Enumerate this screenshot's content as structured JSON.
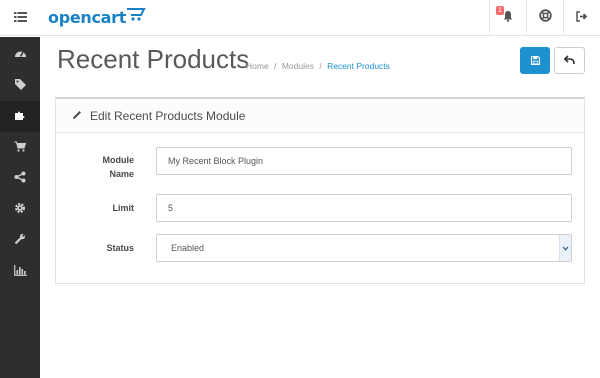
{
  "header": {
    "logo_text": "opencart",
    "notification_count": "1"
  },
  "icons": {
    "menu": "menu-icon",
    "bell": "bell-icon",
    "help": "life-ring-icon",
    "logout": "sign-out-icon",
    "save": "save-icon",
    "back": "reply-icon",
    "pencil": "pencil-icon"
  },
  "sidebar": {
    "items": [
      {
        "icon": "dashboard-icon"
      },
      {
        "icon": "tags-icon"
      },
      {
        "icon": "puzzle-icon",
        "active": true
      },
      {
        "icon": "shopping-cart-icon"
      },
      {
        "icon": "share-icon"
      },
      {
        "icon": "cog-icon"
      },
      {
        "icon": "wrench-icon"
      },
      {
        "icon": "bar-chart-icon"
      }
    ]
  },
  "page": {
    "title": "Recent Products",
    "breadcrumb": [
      "Home",
      "Modules",
      "Recent Products"
    ],
    "breadcrumb_sep": "/"
  },
  "panel": {
    "title": "Edit Recent Products Module"
  },
  "form": {
    "name_label_line1": "Module",
    "name_label_line2": "Name",
    "name_value": "My Recent Block Plugin",
    "limit_label": "Limit",
    "limit_value": "5",
    "status_label": "Status",
    "status_value": "Enabled"
  },
  "colors": {
    "accent": "#1e91cf",
    "sidebar_bg": "#2e2e2e",
    "badge": "#f56b6b"
  }
}
